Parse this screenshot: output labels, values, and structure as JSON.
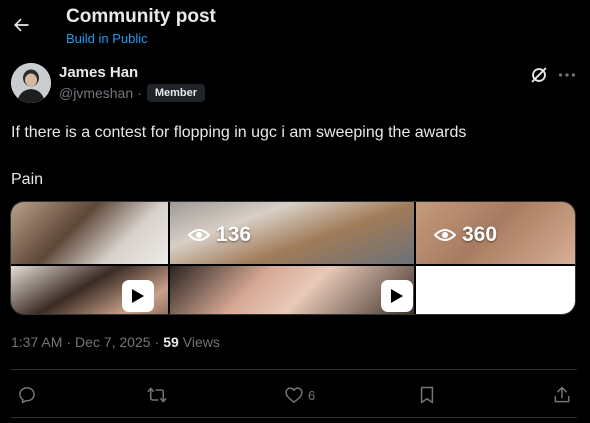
{
  "header": {
    "title": "Community post",
    "community": "Build in Public"
  },
  "post": {
    "author_name": "James Han",
    "handle": "@jvmeshan",
    "separator": "·",
    "badge": "Member",
    "text_line1": "If there is a contest for flopping in ugc i am sweeping the awards",
    "text_line2": "Pain",
    "media": {
      "views_tile2": "136",
      "views_tile3": "360"
    },
    "time": "1:37 AM",
    "date": "Dec 7, 2025",
    "views": "59",
    "views_label": "Views"
  },
  "actions": {
    "like_count": "6"
  },
  "colors": {
    "background": "#000000",
    "text": "#e7e9ea",
    "muted": "#71767b",
    "accent": "#1d9bf0",
    "divider": "#2f3336"
  },
  "icons": [
    "back-arrow-icon",
    "grok-icon",
    "more-icon",
    "eye-icon",
    "play-icon",
    "reply-icon",
    "repost-icon",
    "like-icon",
    "bookmark-icon",
    "share-icon"
  ]
}
